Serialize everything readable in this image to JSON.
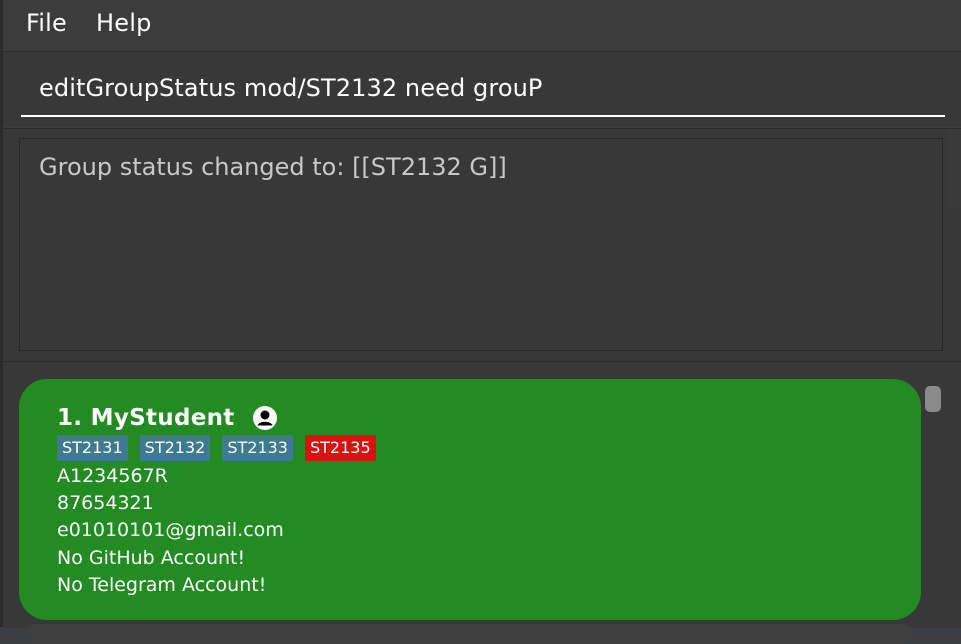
{
  "menu": {
    "file_label": "File",
    "help_label": "Help"
  },
  "command": {
    "value": "editGroupStatus mod/ST2132 need grouP"
  },
  "result": {
    "text": "Group status changed to: [[ST2132 G]]"
  },
  "person_list": {
    "persons": [
      {
        "name": "1. MyStudent",
        "avatar_icon": "user-avatar-icon",
        "tags": [
          {
            "label": "ST2131",
            "color": "#3e7b91"
          },
          {
            "label": "ST2132",
            "color": "#3e7b91"
          },
          {
            "label": "ST2133",
            "color": "#3e7b91"
          },
          {
            "label": "ST2135",
            "color": "#dd1010"
          }
        ],
        "student_id": "A1234567R",
        "phone": "87654321",
        "email": "e01010101@gmail.com",
        "github": "No GitHub Account!",
        "telegram": "No Telegram Account!"
      }
    ]
  },
  "colors": {
    "card_background": "#228b22",
    "app_background": "#383838"
  }
}
